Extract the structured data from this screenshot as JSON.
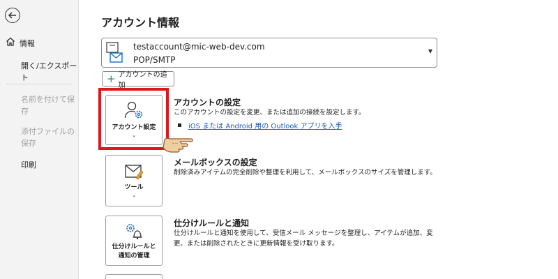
{
  "sidebar": {
    "items": [
      {
        "label": "情報"
      },
      {
        "label": "開く/エクスポート"
      },
      {
        "label": "名前を付けて保存"
      },
      {
        "label": "添付ファイルの保存"
      },
      {
        "label": "印刷"
      }
    ]
  },
  "main": {
    "title": "アカウント情報",
    "account": {
      "email": "testaccount@mic-web-dev.com",
      "protocol": "POP/SMTP"
    },
    "add_account_label": "アカウントの追加",
    "sections": [
      {
        "tile_label": "アカウント設定",
        "title": "アカウントの設定",
        "description": "このアカウントの設定を変更、または追加の接続を設定します。",
        "link": "iOS または Android 用の Outlook アプリを入手"
      },
      {
        "tile_label": "ツール",
        "title": "メールボックスの設定",
        "description": "削除済みアイテムの完全削除や整理を利用して、メールボックスのサイズを管理します。"
      },
      {
        "tile_label_line1": "仕分けルールと",
        "tile_label_line2": "通知の管理",
        "title": "仕分けルールと通知",
        "description": "仕分けルールと通知を使用して、受信メール メッセージを整理し、アイテムが追加、変更、または削除されたときに更新情報を受け取ります。"
      }
    ]
  },
  "colors": {
    "highlight": "#e0161b",
    "link": "#1a5bb8",
    "accent": "#0f6cbd"
  },
  "icons": [
    "back-arrow-icon",
    "home-icon",
    "account-mail-icon",
    "plus-icon",
    "account-settings-icon",
    "mailbox-tools-icon",
    "rules-alerts-icon",
    "pointing-hand-icon"
  ]
}
